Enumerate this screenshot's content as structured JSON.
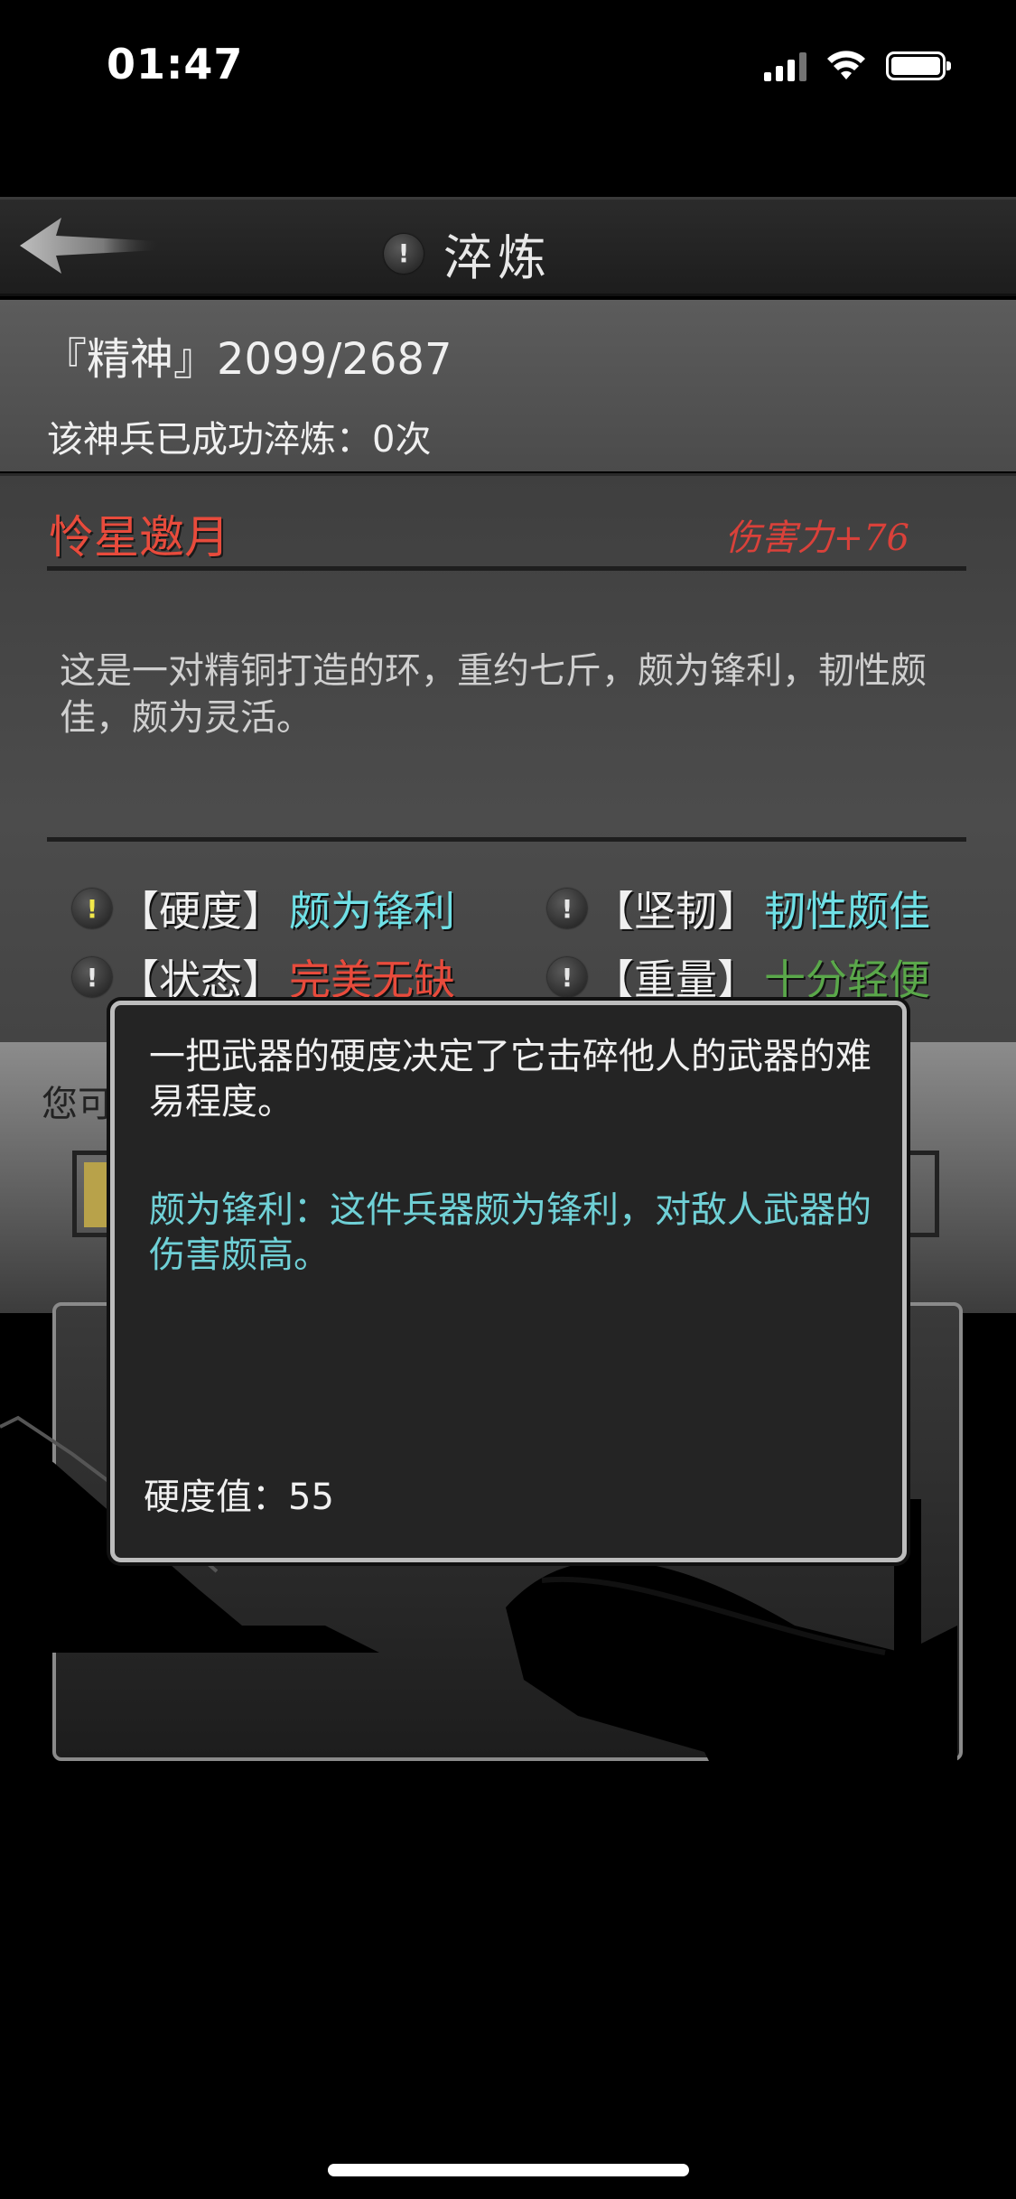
{
  "status_bar": {
    "time": "01:47"
  },
  "header": {
    "title": "淬炼"
  },
  "weapon": {
    "spirit": "『精神』2099/2687",
    "refine_count": "该神兵已成功淬炼：0次",
    "name": "怜星邀月",
    "damage": "伤害力+76",
    "description": "这是一对精铜打造的环，重约七斤，颇为锋利，韧性颇佳，颇为灵活。",
    "attributes": [
      {
        "key": "【硬度】",
        "value": "颇为锋利",
        "color": "#6fe0e6",
        "icon_color": "#f2e84a"
      },
      {
        "key": "【坚韧】",
        "value": "韧性颇佳",
        "color": "#6fe0e6",
        "icon_color": "#e8e8e8"
      },
      {
        "key": "【状态】",
        "value": "完美无缺",
        "color": "#e84b3c",
        "icon_color": "#e8e8e8"
      },
      {
        "key": "【重量】",
        "value": "十分轻便",
        "color": "#5aa84a",
        "icon_color": "#e8e8e8"
      }
    ]
  },
  "lower": {
    "hint_partial": "您可"
  },
  "tooltip": {
    "description": "一把武器的硬度决定了它击碎他人的武器的难易程度。",
    "detail": "颇为锋利：这件兵器颇为锋利，对敌人武器的伤害颇高。",
    "value_text": "硬度值：55"
  }
}
